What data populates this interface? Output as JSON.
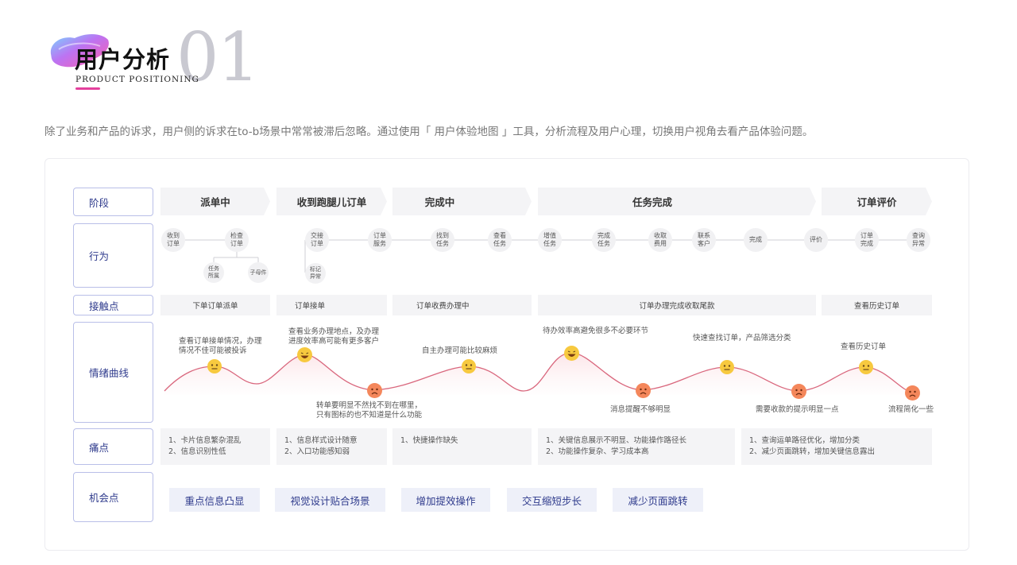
{
  "header": {
    "title": "用户分析",
    "number": "01",
    "subtitle": "PRODUCT POSITIONING"
  },
  "intro": "除了业务和产品的诉求，用户侧的诉求在to-b场景中常常被滞后忽略。通过使用「 用户体验地图 」工具，分析流程及用户心理，切换用户视角去看产品体验问题。",
  "rows": {
    "stage": "阶段",
    "action": "行为",
    "touch": "接触点",
    "emotion": "情绪曲线",
    "pain": "痛点",
    "opportunity": "机会点"
  },
  "stages": [
    "派单中",
    "收到跑腿儿订单",
    "完成中",
    "任务完成",
    "订单评价"
  ],
  "actions": [
    "收到\n订单",
    "检查\n订单",
    "任务\n所属",
    "子母件",
    "交接\n订单",
    "标记\n异常",
    "订单\n服务",
    "找到\n任务",
    "查看\n任务",
    "增值\n任务",
    "完成\n任务",
    "收取\n费用",
    "联系\n客户",
    "完成",
    "评价",
    "订单\n完成",
    "查询\n异常"
  ],
  "touchpoints": [
    "下单订单派单",
    "订单接单",
    "订单收费办理中",
    "订单办理完成收取尾款",
    "查看历史订单"
  ],
  "emotions": [
    "查看订单接单情况，办理\n情况不佳可能被投诉",
    "查看业务办理地点，及办理\n进度效率高可能有更多客户",
    "转单要明显不然找不到在哪里，\n只有图标的也不知道是什么功能",
    "自主办理可能比较麻烦",
    "待办效率高避免很多不必要环节",
    "消息提醒不够明显",
    "快速查找订单，产品筛选分类",
    "需要收款的提示明显一点",
    "查看历史订单",
    "流程简化一些"
  ],
  "pains": [
    "1、卡片信息繁杂混乱\n2、信息识别性低",
    "1、信息样式设计随意\n2、入口功能感知弱",
    "1、快捷操作缺失",
    "1、关键信息展示不明显、功能操作路径长\n2、功能操作复杂、学习成本高",
    "1、查询运单路径优化，增加分类\n2、减少页面跳转，增加关键信息露出"
  ],
  "opportunities": [
    "重点信息凸显",
    "视觉设计贴合场景",
    "增加提效操作",
    "交互缩短步长",
    "减少页面跳转"
  ],
  "colors": {
    "accent": "#2e3a8c",
    "curve": "#d9677d",
    "brand_pink": "#e4409d"
  }
}
